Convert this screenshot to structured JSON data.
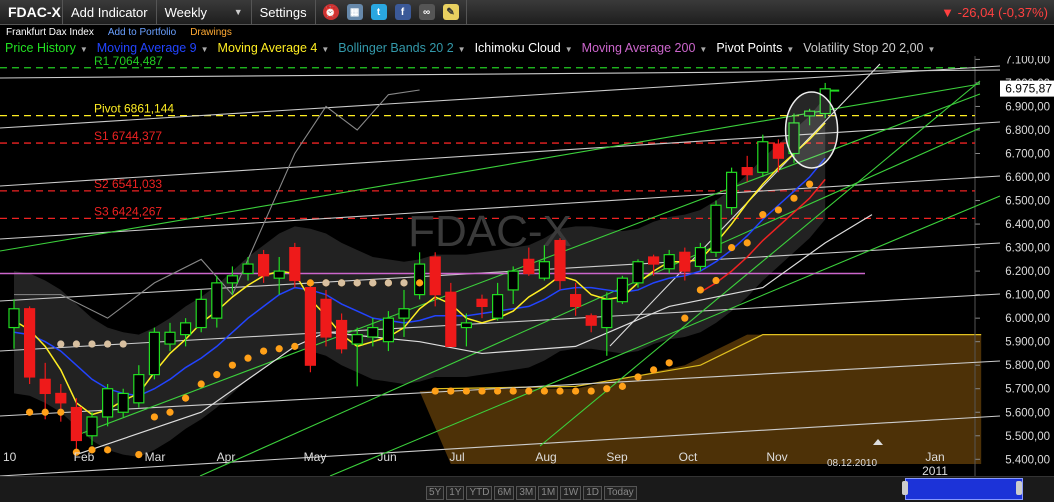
{
  "toolbar": {
    "symbol": "FDAC-X",
    "add_indicator": "Add Indicator",
    "interval": "Weekly",
    "settings": "Settings",
    "change": "-26,04 (-0,37%)"
  },
  "subbar": {
    "instrument_name": "Frankfurt Dax Index",
    "add_to_portfolio": "Add to Portfolio",
    "drawings": "Drawings"
  },
  "legend": [
    {
      "label": "Price History",
      "color": "#22e022"
    },
    {
      "label": "Moving Average 9",
      "color": "#2244ff"
    },
    {
      "label": "Moving Average 4",
      "color": "#ffee22"
    },
    {
      "label": "Bollinger Bands 20 2",
      "color": "#3399aa"
    },
    {
      "label": "Ichimoku Cloud",
      "color": "#ffffff"
    },
    {
      "label": "Moving Average 200",
      "color": "#cc66cc"
    },
    {
      "label": "Pivot Points",
      "color": "#ffffff"
    },
    {
      "label": "Volatility Stop 20 2,00",
      "color": "#cccccc"
    }
  ],
  "chart_data": {
    "type": "candlestick",
    "watermark": "FDAC-X",
    "yticks": [
      5400,
      5500,
      5600,
      5700,
      5800,
      5900,
      6000,
      6100,
      6200,
      6300,
      6400,
      6500,
      6600,
      6700,
      6800,
      6900,
      7000,
      7100
    ],
    "ylim": [
      5380,
      7140
    ],
    "ytick_format": "comma_decimal_2",
    "last_price": "6.975,87",
    "pivot_lines": [
      {
        "label": "R1 7064,487",
        "value": 7064.487,
        "color": "#22cc22"
      },
      {
        "label": "Pivot 6861,144",
        "value": 6861.144,
        "color": "#ffee22"
      },
      {
        "label": "S1 6744,377",
        "value": 6744.377,
        "color": "#ee2222"
      },
      {
        "label": "S2 6541,033",
        "value": 6541.033,
        "color": "#ee2222"
      },
      {
        "label": "S3 6424,267",
        "value": 6424.267,
        "color": "#ee2222"
      }
    ],
    "month_labels": [
      "10",
      "Feb",
      "Mar",
      "Apr",
      "May",
      "Jun",
      "Jul",
      "Aug",
      "Sep",
      "Oct",
      "Nov",
      "Jan"
    ],
    "year_label": "2011",
    "date_marker": "08.12.2010",
    "candles": [
      {
        "o": 5960,
        "h": 6080,
        "l": 5870,
        "c": 6040
      },
      {
        "o": 6040,
        "h": 6050,
        "l": 5720,
        "c": 5750
      },
      {
        "o": 5740,
        "h": 5810,
        "l": 5570,
        "c": 5680
      },
      {
        "o": 5680,
        "h": 5720,
        "l": 5560,
        "c": 5640
      },
      {
        "o": 5620,
        "h": 5660,
        "l": 5430,
        "c": 5480
      },
      {
        "o": 5500,
        "h": 5600,
        "l": 5460,
        "c": 5580
      },
      {
        "o": 5580,
        "h": 5720,
        "l": 5540,
        "c": 5700
      },
      {
        "o": 5600,
        "h": 5700,
        "l": 5580,
        "c": 5680
      },
      {
        "o": 5640,
        "h": 5800,
        "l": 5620,
        "c": 5760
      },
      {
        "o": 5760,
        "h": 5960,
        "l": 5740,
        "c": 5940
      },
      {
        "o": 5890,
        "h": 5980,
        "l": 5860,
        "c": 5940
      },
      {
        "o": 5930,
        "h": 6000,
        "l": 5880,
        "c": 5980
      },
      {
        "o": 5960,
        "h": 6120,
        "l": 5940,
        "c": 6080
      },
      {
        "o": 6000,
        "h": 6180,
        "l": 5960,
        "c": 6150
      },
      {
        "o": 6150,
        "h": 6220,
        "l": 6100,
        "c": 6180
      },
      {
        "o": 6190,
        "h": 6260,
        "l": 6160,
        "c": 6230
      },
      {
        "o": 6270,
        "h": 6290,
        "l": 6150,
        "c": 6180
      },
      {
        "o": 6170,
        "h": 6260,
        "l": 6100,
        "c": 6200
      },
      {
        "o": 6300,
        "h": 6320,
        "l": 6130,
        "c": 6160
      },
      {
        "o": 6130,
        "h": 6140,
        "l": 5770,
        "c": 5800
      },
      {
        "o": 6080,
        "h": 6120,
        "l": 5880,
        "c": 5920
      },
      {
        "o": 5990,
        "h": 6020,
        "l": 5850,
        "c": 5870
      },
      {
        "o": 5890,
        "h": 5960,
        "l": 5710,
        "c": 5930
      },
      {
        "o": 5920,
        "h": 6000,
        "l": 5880,
        "c": 5960
      },
      {
        "o": 5900,
        "h": 6030,
        "l": 5860,
        "c": 6000
      },
      {
        "o": 6000,
        "h": 6120,
        "l": 5920,
        "c": 6040
      },
      {
        "o": 6100,
        "h": 6280,
        "l": 6080,
        "c": 6230
      },
      {
        "o": 6260,
        "h": 6280,
        "l": 6050,
        "c": 6100
      },
      {
        "o": 6110,
        "h": 6150,
        "l": 5880,
        "c": 5880
      },
      {
        "o": 5960,
        "h": 6020,
        "l": 5880,
        "c": 5980
      },
      {
        "o": 6080,
        "h": 6100,
        "l": 6000,
        "c": 6050
      },
      {
        "o": 6000,
        "h": 6150,
        "l": 5990,
        "c": 6100
      },
      {
        "o": 6120,
        "h": 6220,
        "l": 6060,
        "c": 6200
      },
      {
        "o": 6250,
        "h": 6300,
        "l": 6180,
        "c": 6190
      },
      {
        "o": 6170,
        "h": 6310,
        "l": 6160,
        "c": 6240
      },
      {
        "o": 6330,
        "h": 6340,
        "l": 6120,
        "c": 6160
      },
      {
        "o": 6100,
        "h": 6150,
        "l": 6010,
        "c": 6050
      },
      {
        "o": 6010,
        "h": 6020,
        "l": 5940,
        "c": 5970
      },
      {
        "o": 5960,
        "h": 6110,
        "l": 5840,
        "c": 6080
      },
      {
        "o": 6070,
        "h": 6180,
        "l": 6060,
        "c": 6170
      },
      {
        "o": 6150,
        "h": 6250,
        "l": 6130,
        "c": 6240
      },
      {
        "o": 6260,
        "h": 6270,
        "l": 6180,
        "c": 6230
      },
      {
        "o": 6210,
        "h": 6290,
        "l": 6190,
        "c": 6270
      },
      {
        "o": 6280,
        "h": 6300,
        "l": 6160,
        "c": 6200
      },
      {
        "o": 6220,
        "h": 6320,
        "l": 6200,
        "c": 6300
      },
      {
        "o": 6280,
        "h": 6500,
        "l": 6260,
        "c": 6480
      },
      {
        "o": 6470,
        "h": 6640,
        "l": 6440,
        "c": 6620
      },
      {
        "o": 6640,
        "h": 6690,
        "l": 6580,
        "c": 6610
      },
      {
        "o": 6620,
        "h": 6780,
        "l": 6600,
        "c": 6750
      },
      {
        "o": 6740,
        "h": 6760,
        "l": 6620,
        "c": 6680
      },
      {
        "o": 6700,
        "h": 6870,
        "l": 6660,
        "c": 6830
      },
      {
        "o": 6860,
        "h": 6890,
        "l": 6820,
        "c": 6880
      },
      {
        "o": 6870,
        "h": 7000,
        "l": 6850,
        "c": 6975
      }
    ],
    "ma4": [
      5990,
      5950,
      5880,
      5780,
      5640,
      5590,
      5610,
      5650,
      5680,
      5770,
      5850,
      5910,
      5980,
      6030,
      6090,
      6140,
      6180,
      6200,
      6190,
      6080,
      6010,
      5930,
      5880,
      5900,
      5920,
      5960,
      6040,
      6090,
      6060,
      6000,
      5980,
      6000,
      6030,
      6090,
      6130,
      6180,
      6160,
      6100,
      6080,
      6090,
      6150,
      6200,
      6240,
      6240,
      6250,
      6320,
      6400,
      6490,
      6570,
      6640,
      6700,
      6760,
      6830
    ],
    "ma9": [
      5940,
      5930,
      5900,
      5860,
      5800,
      5740,
      5700,
      5680,
      5670,
      5700,
      5740,
      5790,
      5830,
      5880,
      5940,
      6000,
      6050,
      6100,
      6130,
      6120,
      6100,
      6060,
      6030,
      6000,
      5990,
      5980,
      5990,
      6010,
      6010,
      6010,
      6020,
      6030,
      6040,
      6050,
      6080,
      6120,
      6130,
      6130,
      6120,
      6110,
      6120,
      6150,
      6170,
      6180,
      6200,
      6240,
      6290,
      6350,
      6420,
      6480,
      6540,
      6600,
      6680
    ],
    "ma200": 6190,
    "vstop_dots": [
      {
        "i": 1,
        "v": 5600
      },
      {
        "i": 2,
        "v": 5600
      },
      {
        "i": 3,
        "v": 5600
      },
      {
        "i": 4,
        "v": 5430
      },
      {
        "i": 5,
        "v": 5440
      },
      {
        "i": 6,
        "v": 5440
      },
      {
        "i": 8,
        "v": 5420
      },
      {
        "i": 9,
        "v": 5580
      },
      {
        "i": 10,
        "v": 5600
      },
      {
        "i": 11,
        "v": 5660
      },
      {
        "i": 12,
        "v": 5720
      },
      {
        "i": 13,
        "v": 5760
      },
      {
        "i": 14,
        "v": 5800
      },
      {
        "i": 15,
        "v": 5830
      },
      {
        "i": 16,
        "v": 5860
      },
      {
        "i": 17,
        "v": 5870
      },
      {
        "i": 18,
        "v": 5880
      },
      {
        "i": 19,
        "v": 6150
      },
      {
        "i": 20,
        "v": 6150
      },
      {
        "i": 21,
        "v": 6150
      },
      {
        "i": 22,
        "v": 6150
      },
      {
        "i": 23,
        "v": 6150
      },
      {
        "i": 24,
        "v": 6150
      },
      {
        "i": 25,
        "v": 6150
      },
      {
        "i": 26,
        "v": 6150
      },
      {
        "i": 27,
        "v": 5690
      },
      {
        "i": 28,
        "v": 5690
      },
      {
        "i": 29,
        "v": 5690
      },
      {
        "i": 30,
        "v": 5690
      },
      {
        "i": 31,
        "v": 5690
      },
      {
        "i": 32,
        "v": 5690
      },
      {
        "i": 33,
        "v": 5690
      },
      {
        "i": 34,
        "v": 5690
      },
      {
        "i": 35,
        "v": 5690
      },
      {
        "i": 36,
        "v": 5690
      },
      {
        "i": 37,
        "v": 5690
      },
      {
        "i": 38,
        "v": 5700
      },
      {
        "i": 39,
        "v": 5710
      },
      {
        "i": 40,
        "v": 5750
      },
      {
        "i": 41,
        "v": 5780
      },
      {
        "i": 42,
        "v": 5810
      },
      {
        "i": 43,
        "v": 6000
      },
      {
        "i": 44,
        "v": 6120
      },
      {
        "i": 45,
        "v": 6160
      },
      {
        "i": 46,
        "v": 6300
      },
      {
        "i": 47,
        "v": 6320
      },
      {
        "i": 48,
        "v": 6440
      },
      {
        "i": 49,
        "v": 6460
      },
      {
        "i": 50,
        "v": 6510
      },
      {
        "i": 51,
        "v": 6570
      }
    ],
    "tan_dots": [
      {
        "i": 3,
        "v": 5890
      },
      {
        "i": 4,
        "v": 5890
      },
      {
        "i": 5,
        "v": 5890
      },
      {
        "i": 6,
        "v": 5890
      },
      {
        "i": 7,
        "v": 5890
      },
      {
        "i": 20,
        "v": 6150
      },
      {
        "i": 21,
        "v": 6150
      },
      {
        "i": 22,
        "v": 6150
      },
      {
        "i": 23,
        "v": 6150
      },
      {
        "i": 24,
        "v": 6150
      },
      {
        "i": 25,
        "v": 6150
      }
    ]
  }
}
